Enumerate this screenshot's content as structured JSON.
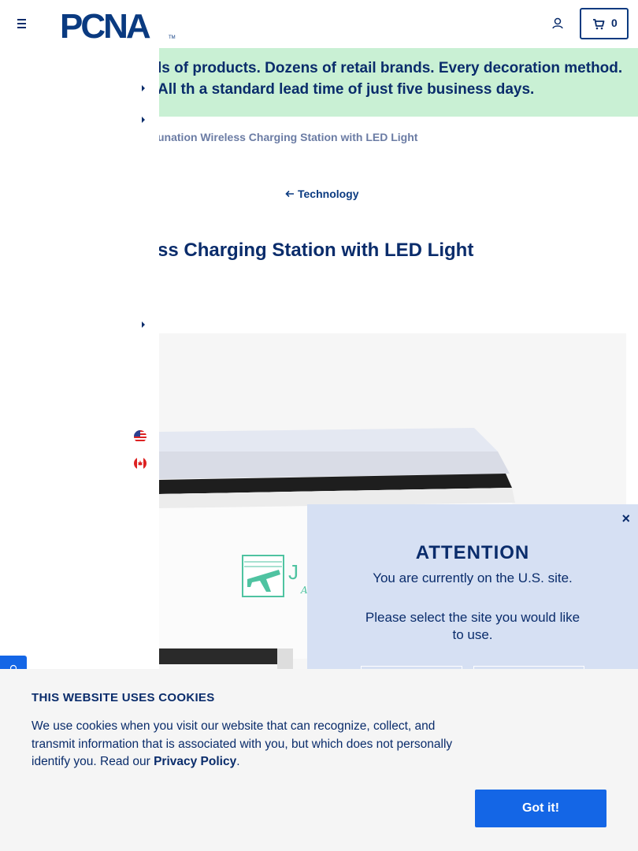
{
  "header": {
    "logo_text": "PCNA",
    "logo_tm": "TM",
    "cart_count": "0"
  },
  "promo": {
    "text": "ls of products. Dozens of retail brands. Every decoration method. All th a standard lead time of just five business days."
  },
  "breadcrumb": {
    "current": "unation Wireless Charging Station with LED Light"
  },
  "back_link": {
    "label": "Technology"
  },
  "product": {
    "title": "ss Charging Station with LED Light",
    "image_print_text": "J E",
    "image_script_text": "A"
  },
  "site_selector": {
    "flags": [
      "us-flag",
      "canada-flag"
    ]
  },
  "attention_modal": {
    "close_label": "×",
    "title": "ATTENTION",
    "line1": "You are currently on the U.S. site.",
    "line2": "Please select the site you would like to use."
  },
  "cookie_banner": {
    "title": "THIS WEBSITE USES COOKIES",
    "body_prefix": "We use cookies when you visit our website that can recognize, collect, and transmit information that is associated with you, but which does not personally identify you. Read our ",
    "privacy_link": "Privacy Policy",
    "body_suffix": ".",
    "accept_label": "Got it!"
  },
  "colors": {
    "navy": "#0a2c6b",
    "promo_bg": "#c9f0d4",
    "modal_bg": "#d6e0f3",
    "accept_button": "#1466e6",
    "logo_teal": "#4fc3a1"
  }
}
